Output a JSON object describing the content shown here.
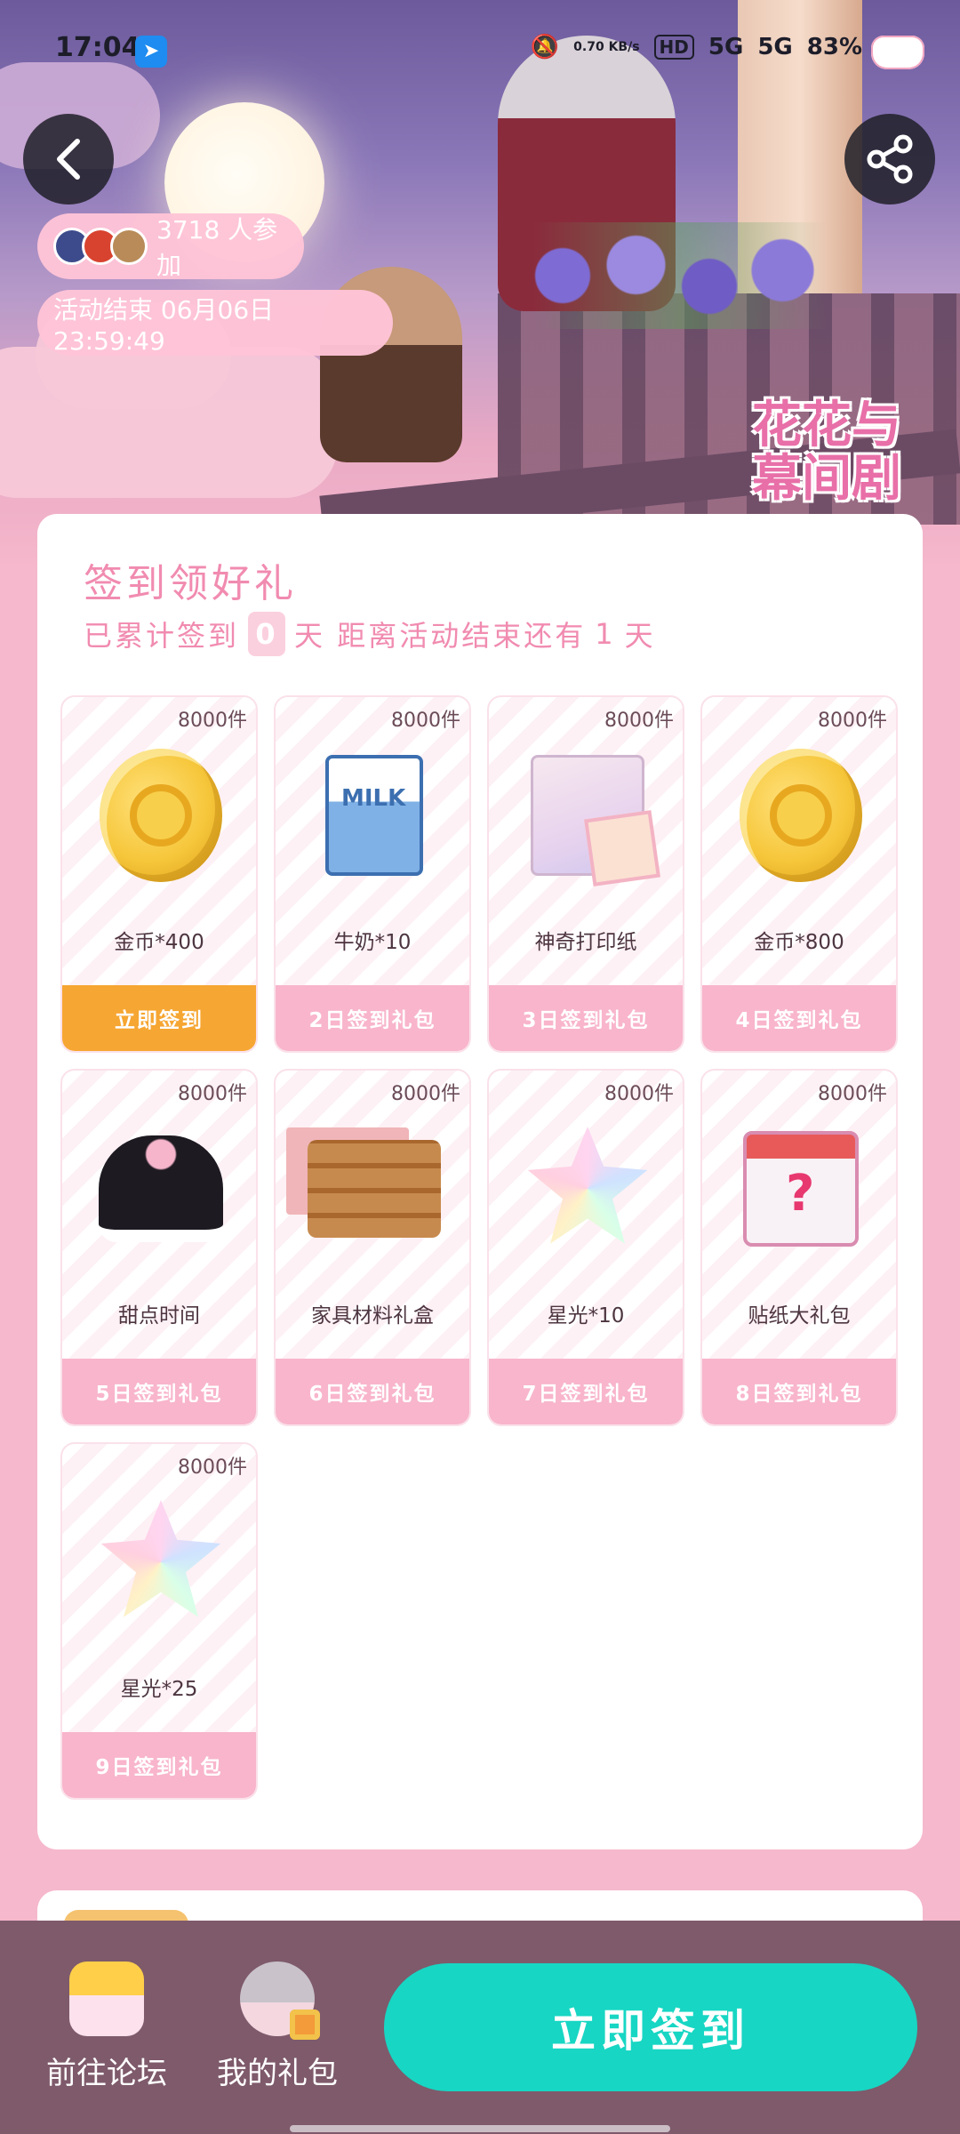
{
  "status_bar": {
    "time": "17:04",
    "net_speed": "0.70 KB/s",
    "hd": "HD",
    "signal1": "5G",
    "signal2": "5G",
    "battery": "83%"
  },
  "banner": {
    "participants": "3718 人参加",
    "deadline": "活动结束 06月06日 23:59:49",
    "logo_text": "花花与幕间剧"
  },
  "checkin": {
    "title": "签到领好礼",
    "subtitle_prefix": "已累计签到",
    "days": "0",
    "subtitle_mid": "天  距离活动结束还有",
    "days_left": "1",
    "subtitle_suffix": "天"
  },
  "rewards": [
    {
      "count": "8000件",
      "name": "金币*400",
      "button": "立即签到",
      "icon": "gold-coin-icon",
      "active": true
    },
    {
      "count": "8000件",
      "name": "牛奶*10",
      "button": "2日签到礼包",
      "icon": "milk-carton-icon"
    },
    {
      "count": "8000件",
      "name": "神奇打印纸",
      "button": "3日签到礼包",
      "icon": "magic-print-paper-icon"
    },
    {
      "count": "8000件",
      "name": "金币*800",
      "button": "4日签到礼包",
      "icon": "gold-coin-icon"
    },
    {
      "count": "8000件",
      "name": "甜点时间",
      "button": "5日签到礼包",
      "icon": "maid-dress-icon"
    },
    {
      "count": "8000件",
      "name": "家具材料礼盒",
      "button": "6日签到礼包",
      "icon": "furniture-material-icon"
    },
    {
      "count": "8000件",
      "name": "星光*10",
      "button": "7日签到礼包",
      "icon": "starlight-icon"
    },
    {
      "count": "8000件",
      "name": "贴纸大礼包",
      "button": "8日签到礼包",
      "icon": "sticker-pack-icon"
    },
    {
      "count": "8000件",
      "name": "星光*25",
      "button": "9日签到礼包",
      "icon": "starlight-icon"
    }
  ],
  "bottom_bar": {
    "forum_label": "前往论坛",
    "gifts_label": "我的礼包",
    "cta_label": "立即签到"
  },
  "colors": {
    "accent_pink": "#f18bb0",
    "active_orange": "#f6a632",
    "cta_teal": "#17d6c3",
    "bottom_bar": "#7e5a6b"
  }
}
